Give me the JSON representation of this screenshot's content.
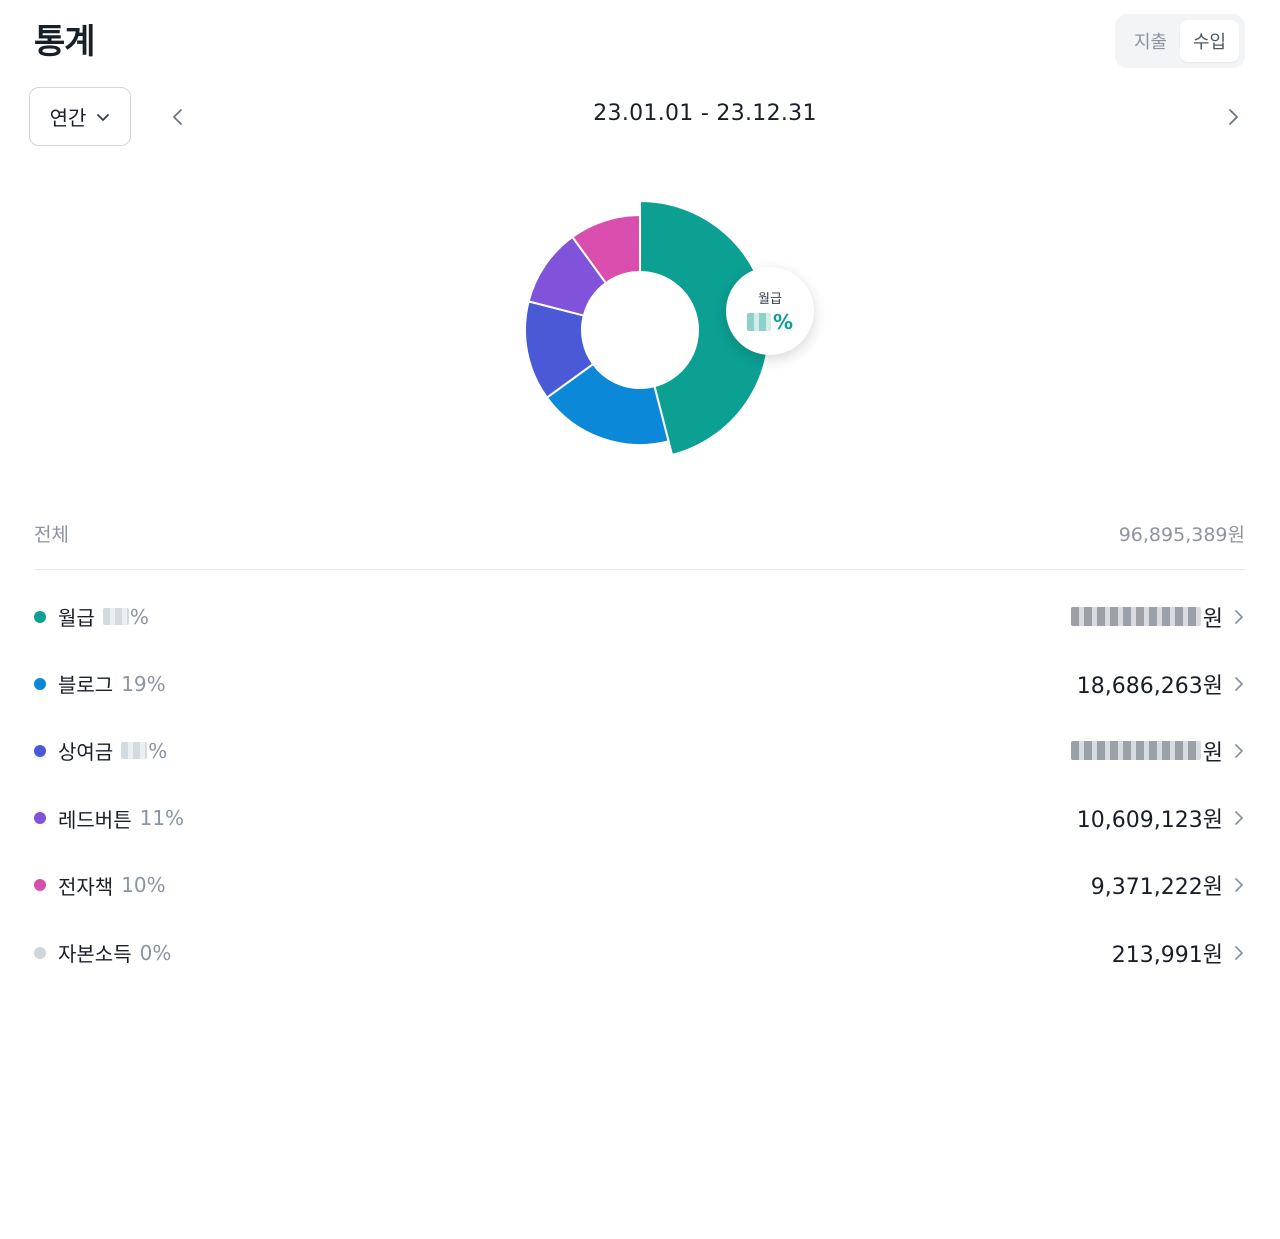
{
  "header": {
    "title": "통계"
  },
  "segment": {
    "options": [
      "지출",
      "수입"
    ],
    "selected": "수입"
  },
  "period": {
    "label": "연간"
  },
  "date_range": "23.01.01 - 23.12.31",
  "callout": {
    "label": "월급",
    "percent_suffix": "%"
  },
  "total": {
    "label": "전체",
    "amount": "96,895,389원"
  },
  "categories": [
    {
      "name": "월급",
      "percent": "%",
      "percent_hidden": true,
      "amount": "원",
      "amount_hidden": true,
      "color": "#0ca093",
      "share": 0.46
    },
    {
      "name": "블로그",
      "percent": "19%",
      "amount": "18,686,263원",
      "color": "#0b88d8",
      "share": 0.19
    },
    {
      "name": "상여금",
      "percent": "%",
      "percent_hidden": true,
      "amount": "원",
      "amount_hidden": true,
      "color": "#4a5ad6",
      "share": 0.14
    },
    {
      "name": "레드버튼",
      "percent": "11%",
      "amount": "10,609,123원",
      "color": "#8152da",
      "share": 0.11
    },
    {
      "name": "전자책",
      "percent": "10%",
      "amount": "9,371,222원",
      "color": "#da4fad",
      "share": 0.1
    },
    {
      "name": "자본소득",
      "percent": "0%",
      "amount": "213,991원",
      "color": "#d1d6db",
      "share": 0.0
    }
  ],
  "icons": {
    "period_dropdown": "chevron-down-icon",
    "prev": "chevron-left-icon",
    "next": "chevron-right-icon",
    "row": "chevron-right-icon"
  }
}
